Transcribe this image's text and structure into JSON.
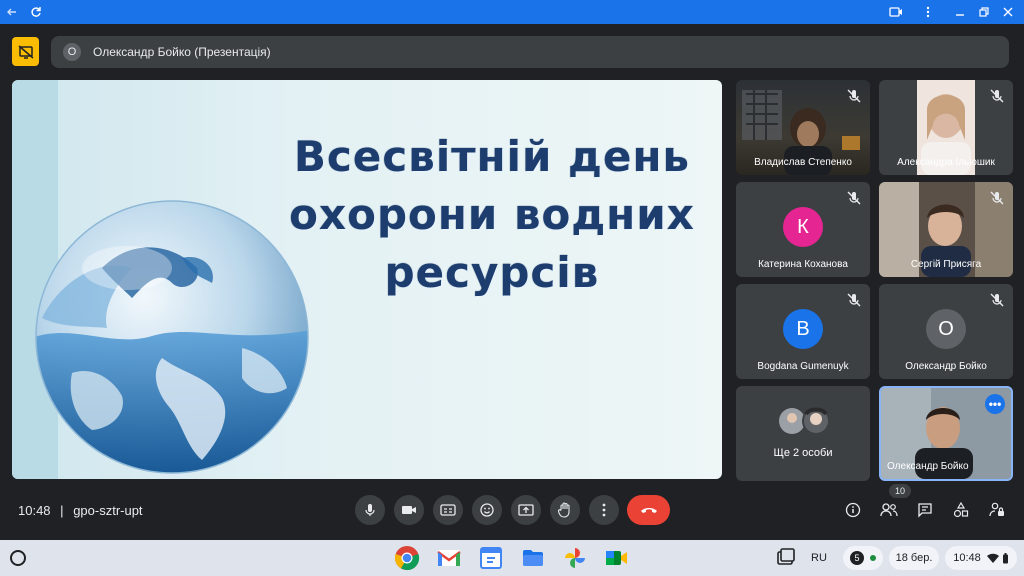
{
  "window": {
    "back_icon": "arrow-left-icon",
    "reload_icon": "reload-icon"
  },
  "meet": {
    "presenter": {
      "avatar_letter": "О",
      "label": "Олександр Бойко (Презентація)"
    },
    "slide": {
      "title_line1": "Всесвітній день",
      "title_line2": "охорони водних",
      "title_line3": "ресурсів"
    },
    "participants": [
      {
        "name": "Владислав Степенко",
        "type": "video"
      },
      {
        "name": "Александра Ільюшик",
        "type": "video"
      },
      {
        "name": "Катерина Коханова",
        "type": "avatar",
        "letter": "К",
        "color": "#e52592"
      },
      {
        "name": "Сергій Присяга",
        "type": "video"
      },
      {
        "name": "Bogdana Gumenuyk",
        "type": "avatar",
        "letter": "B",
        "color": "#1a73e8"
      },
      {
        "name": "Олександр Бойко",
        "type": "avatar",
        "letter": "О",
        "color": "#5f6368"
      },
      {
        "name": "Ще 2 особи",
        "type": "group"
      },
      {
        "name": "Олександр Бойко",
        "type": "self-video"
      }
    ],
    "bottom": {
      "time": "10:48",
      "separator": "|",
      "room_code": "gpo-sztr-upt",
      "people_count": "10"
    }
  },
  "shelf": {
    "ime": "RU",
    "notification_count": "5",
    "date": "18 бер.",
    "time": "10:48"
  },
  "colors": {
    "titlebar": "#1a73e8",
    "meet_bg": "#202124",
    "tile_bg": "#3c4043",
    "hangup": "#ea4335",
    "stop_presenting": "#fbbc04",
    "shelf": "#dfe4ec"
  }
}
